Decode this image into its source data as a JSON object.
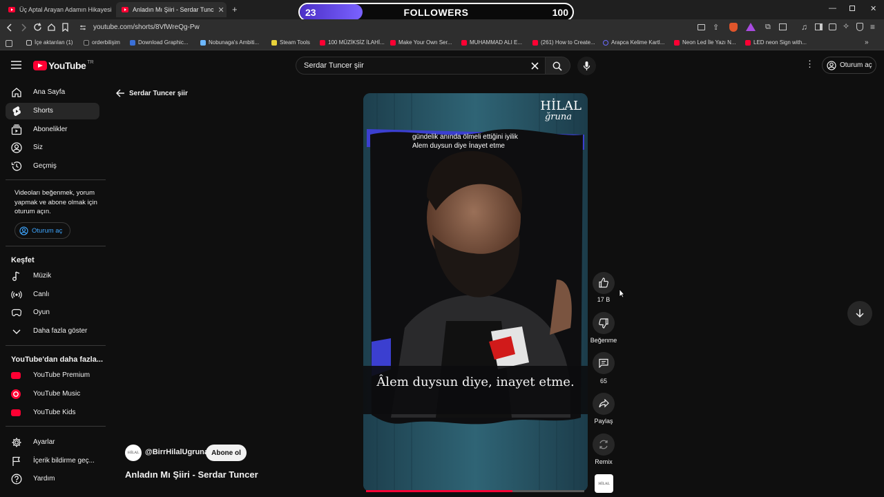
{
  "browser": {
    "tabs": [
      {
        "title": "Üç Aptal Arayan Adamın Hikayesi - B"
      },
      {
        "title": "Anladın Mı Şiiri - Serdar Tunc"
      }
    ],
    "url": "youtube.com/shorts/8VfWreQg-Pw",
    "bookmarks": [
      "İçe aktarılan (1)",
      "orderbilişim",
      "Download Graphic...",
      "Nobunaga's Ambiti...",
      "Steam Tools",
      "100 MÜZİKSİZ İLAHİ...",
      "Make Your Own Ser...",
      "MUHAMMAD ALI E...",
      "(261) How to Create...",
      "Arapca Kelime Kartl...",
      "Neon Led İle Yazı N...",
      "LED neon Sign with..."
    ]
  },
  "overlay": {
    "current": "23",
    "label": "FOLLOWERS",
    "goal": "100",
    "progress_fraction": 0.23
  },
  "youtube": {
    "logo_text": "YouTube",
    "logo_region": "TR",
    "search_value": "Serdar Tuncer şiir",
    "signin_label": "Oturum aç",
    "sidebar": {
      "main": [
        {
          "label": "Ana Sayfa",
          "icon": "home-icon"
        },
        {
          "label": "Shorts",
          "icon": "shorts-icon"
        },
        {
          "label": "Abonelikler",
          "icon": "subscriptions-icon"
        },
        {
          "label": "Siz",
          "icon": "user-icon"
        },
        {
          "label": "Geçmiş",
          "icon": "history-icon"
        }
      ],
      "note": "Videoları beğenmek, yorum yapmak ve abone olmak için oturum açın.",
      "signin_label": "Oturum aç",
      "explore_title": "Keşfet",
      "explore": [
        {
          "label": "Müzik",
          "icon": "music-icon"
        },
        {
          "label": "Canlı",
          "icon": "live-icon"
        },
        {
          "label": "Oyun",
          "icon": "gaming-icon"
        },
        {
          "label": "Daha fazla göster",
          "icon": "chevron-down-icon"
        }
      ],
      "more_title": "YouTube'dan daha fazla...",
      "more": [
        {
          "label": "YouTube Premium"
        },
        {
          "label": "YouTube Music"
        },
        {
          "label": "YouTube Kids"
        }
      ],
      "bottom": [
        {
          "label": "Ayarlar",
          "icon": "settings-icon"
        },
        {
          "label": "İçerik bildirme geç...",
          "icon": "flag-icon"
        },
        {
          "label": "Yardım",
          "icon": "help-icon"
        }
      ]
    },
    "back_label": "Serdar Tuncer şiir",
    "short": {
      "brand_line1": "HİLAL",
      "brand_line2": "ğruna",
      "top_caption_1": "gündelik anında ölmeli ettiğini iyilik",
      "top_caption_2": "Alem duysun diye İnayet etme",
      "bottom_caption": "Âlem duysun diye, inayet etme.",
      "progress_fraction": 0.67
    },
    "channel": "@BirrHilalUgruna",
    "subscribe_label": "Abone ol",
    "video_title": "Anladın Mı Şiiri - Serdar Tuncer",
    "actions": {
      "like_count": "17 B",
      "dislike_label": "Beğenme",
      "comment_count": "65",
      "share_label": "Paylaş",
      "remix_label": "Remix"
    }
  }
}
